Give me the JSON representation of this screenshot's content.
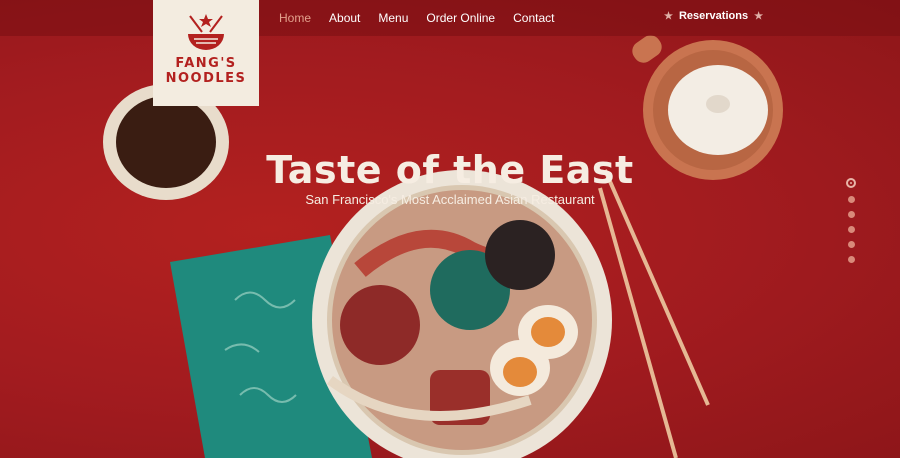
{
  "brand": {
    "line1": "FANG'S",
    "line2": "NOODLES"
  },
  "nav": {
    "items": [
      {
        "label": "Home",
        "active": true
      },
      {
        "label": "About",
        "active": false
      },
      {
        "label": "Menu",
        "active": false
      },
      {
        "label": "Order Online",
        "active": false
      },
      {
        "label": "Contact",
        "active": false
      }
    ],
    "reservations": "Reservations"
  },
  "hero": {
    "title": "Taste of the East",
    "subtitle": "San Francisco's Most Acclaimed Asian Restaurant"
  },
  "slider": {
    "count": 6,
    "active_index": 0
  },
  "colors": {
    "background": "#a11b1f",
    "logo_bg": "#f3ece0",
    "accent": "#b3211f",
    "nav_active": "#e3a18d",
    "napkin": "#1f8a7d"
  }
}
